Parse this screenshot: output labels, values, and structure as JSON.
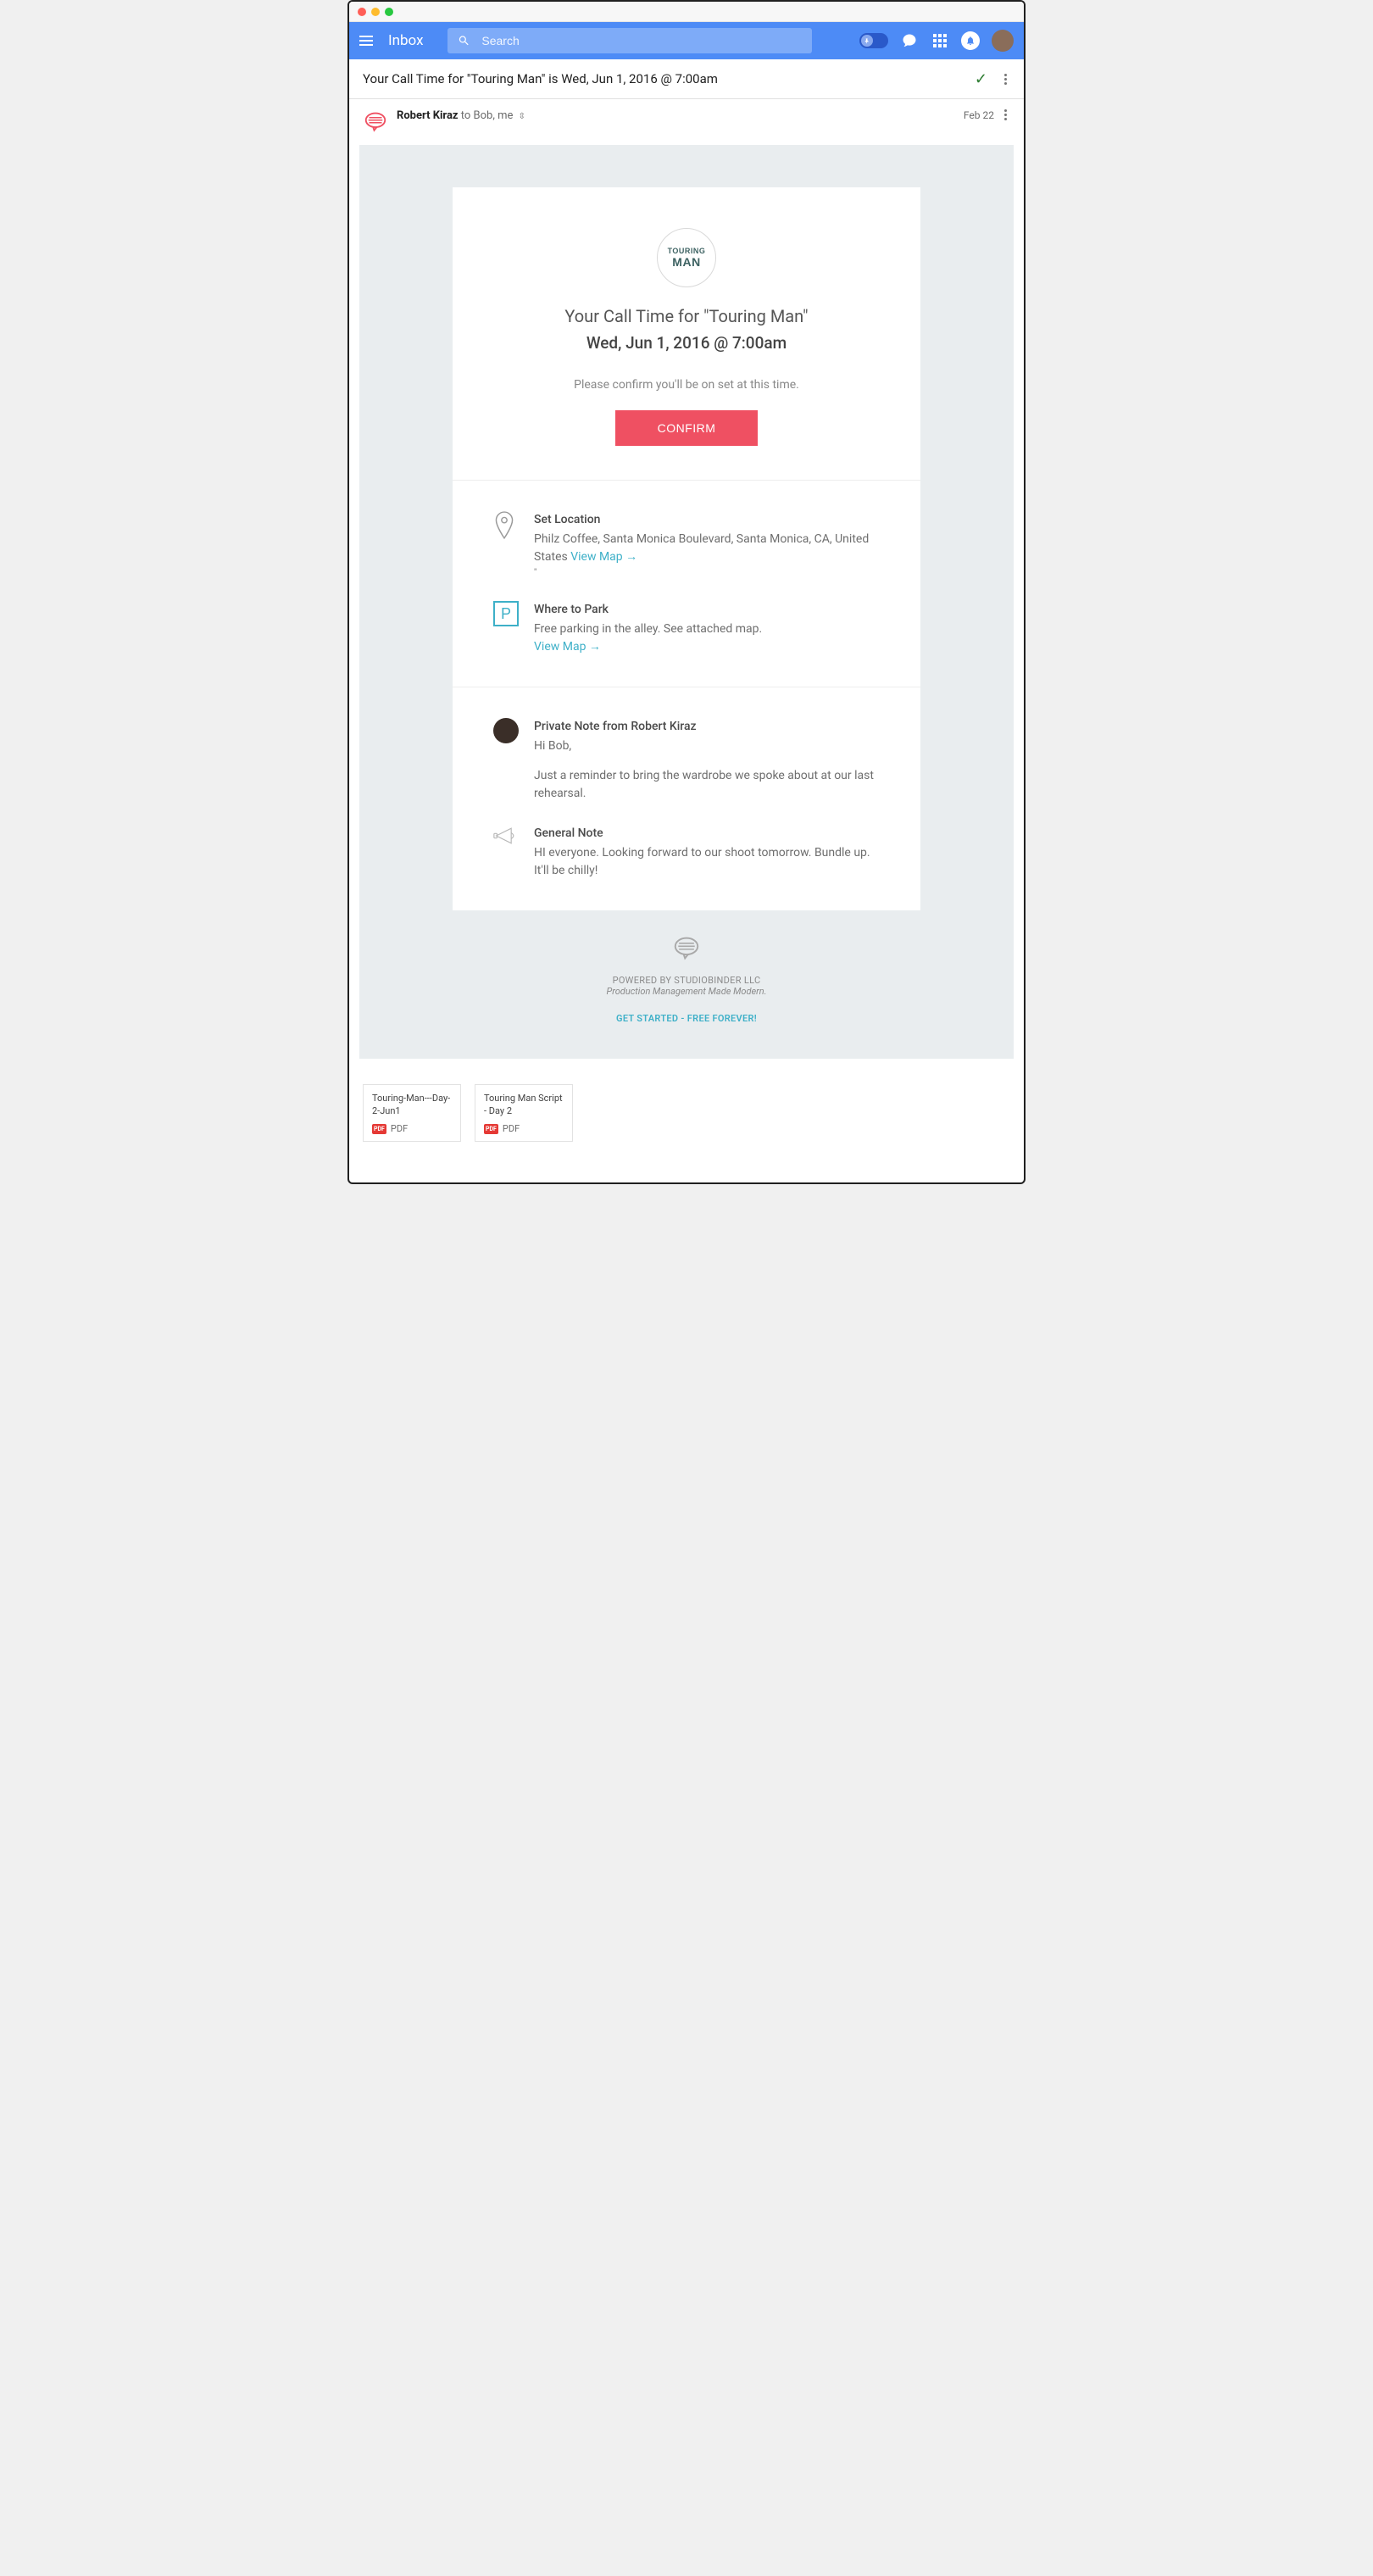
{
  "app": {
    "brand": "Inbox",
    "search_placeholder": "Search"
  },
  "subject": "Your Call Time for \"Touring Man\" is Wed, Jun 1, 2016 @ 7:00am",
  "message": {
    "sender": "Robert Kiraz",
    "recipients": "to Bob, me",
    "date": "Feb 22"
  },
  "email": {
    "logo_line1": "TOURING",
    "logo_line2": "MAN",
    "title1": "Your Call Time for \"Touring Man\"",
    "title2": "Wed, Jun 1, 2016 @ 7:00am",
    "subtitle": "Please confirm you'll be on set at this time.",
    "confirm_label": "CONFIRM",
    "location": {
      "label": "Set Location",
      "text": "Philz Coffee, Santa Monica Boulevard, Santa Monica, CA, United States ",
      "link": "View Map →"
    },
    "parking": {
      "label": "Where to Park",
      "text": "Free parking in the alley. See attached map.",
      "link": "View Map →"
    },
    "private_note": {
      "label": "Private Note from Robert Kiraz",
      "greeting": "Hi Bob,",
      "body": "Just a reminder to bring the wardrobe we spoke about at our last rehearsal."
    },
    "general_note": {
      "label": "General Note",
      "body": "HI everyone. Looking forward to our shoot tomorrow. Bundle up. It'll be chilly!"
    },
    "footer": {
      "line1": "POWERED BY STUDIOBINDER LLC",
      "line2": "Production Management Made Modern.",
      "cta": "GET STARTED - FREE FOREVER!"
    }
  },
  "attachments": [
    {
      "name": "Touring-Man---Day-2-Jun1",
      "type": "PDF"
    },
    {
      "name": "Touring Man Script - Day 2",
      "type": "PDF"
    }
  ]
}
